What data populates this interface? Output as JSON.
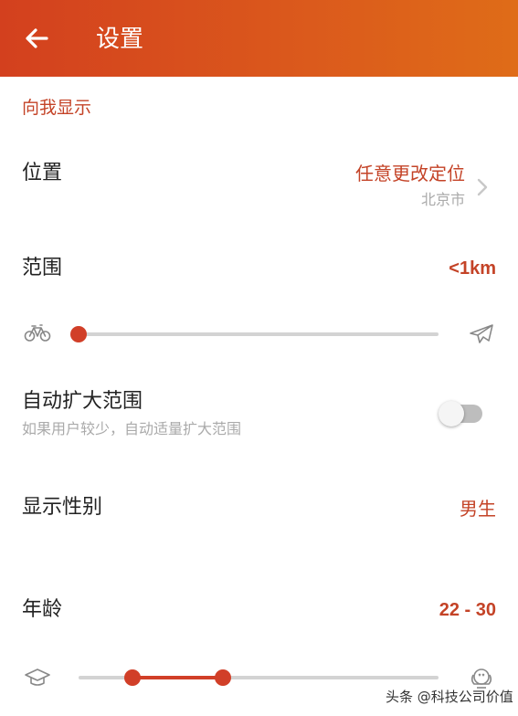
{
  "header": {
    "title": "设置",
    "back_icon": "arrow-left-icon"
  },
  "section": {
    "title": "向我显示"
  },
  "location": {
    "label": "位置",
    "value": "任意更改定位",
    "sub": "北京市"
  },
  "range": {
    "label": "范围",
    "value": "<1km",
    "level": 0.0,
    "left_icon": "bicycle-icon",
    "right_icon": "airplane-icon"
  },
  "auto_expand": {
    "label": "自动扩大范围",
    "sub": "如果用户较少，自动适量扩大范围",
    "enabled": false
  },
  "gender": {
    "label": "显示性别",
    "value": "男生"
  },
  "age": {
    "label": "年龄",
    "value": "22 - 30",
    "low_fraction": 0.15,
    "high_fraction": 0.4,
    "left_icon": "graduation-cap-icon",
    "right_icon": "elder-face-icon"
  },
  "watermark": {
    "text": "头条 @科技公司价值"
  },
  "colors": {
    "accent": "#d13f28",
    "header_start": "#d3401e",
    "header_end": "#df6c18"
  }
}
